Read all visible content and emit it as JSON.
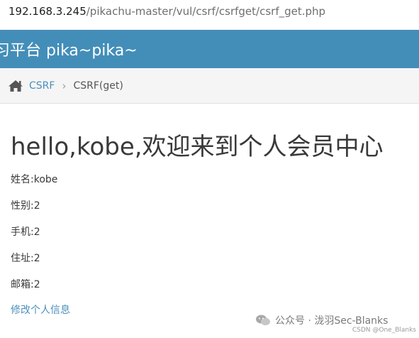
{
  "address_bar": {
    "host": "192.168.3.245",
    "path": "/pikachu-master/vul/csrf/csrfget/csrf_get.php"
  },
  "navbar": {
    "brand": "习平台 pika~pika~"
  },
  "breadcrumb": {
    "home_icon": "home-icon",
    "link": "CSRF",
    "separator": "›",
    "current": "CSRF(get)"
  },
  "content": {
    "welcome": "hello,kobe,欢迎来到个人会员中心",
    "fields": {
      "name": "姓名:kobe",
      "gender": "性别:2",
      "phone": "手机:2",
      "address": "住址:2",
      "email": "邮箱:2"
    },
    "edit_link": "修改个人信息"
  },
  "watermark": {
    "main": "公众号 · 泷羽Sec-Blanks",
    "sub": "CSDN @One_Blanks"
  },
  "colors": {
    "navbar": "#438eb9",
    "link": "#4c8fbd",
    "breadcrumb_bg": "#f5f5f5"
  }
}
